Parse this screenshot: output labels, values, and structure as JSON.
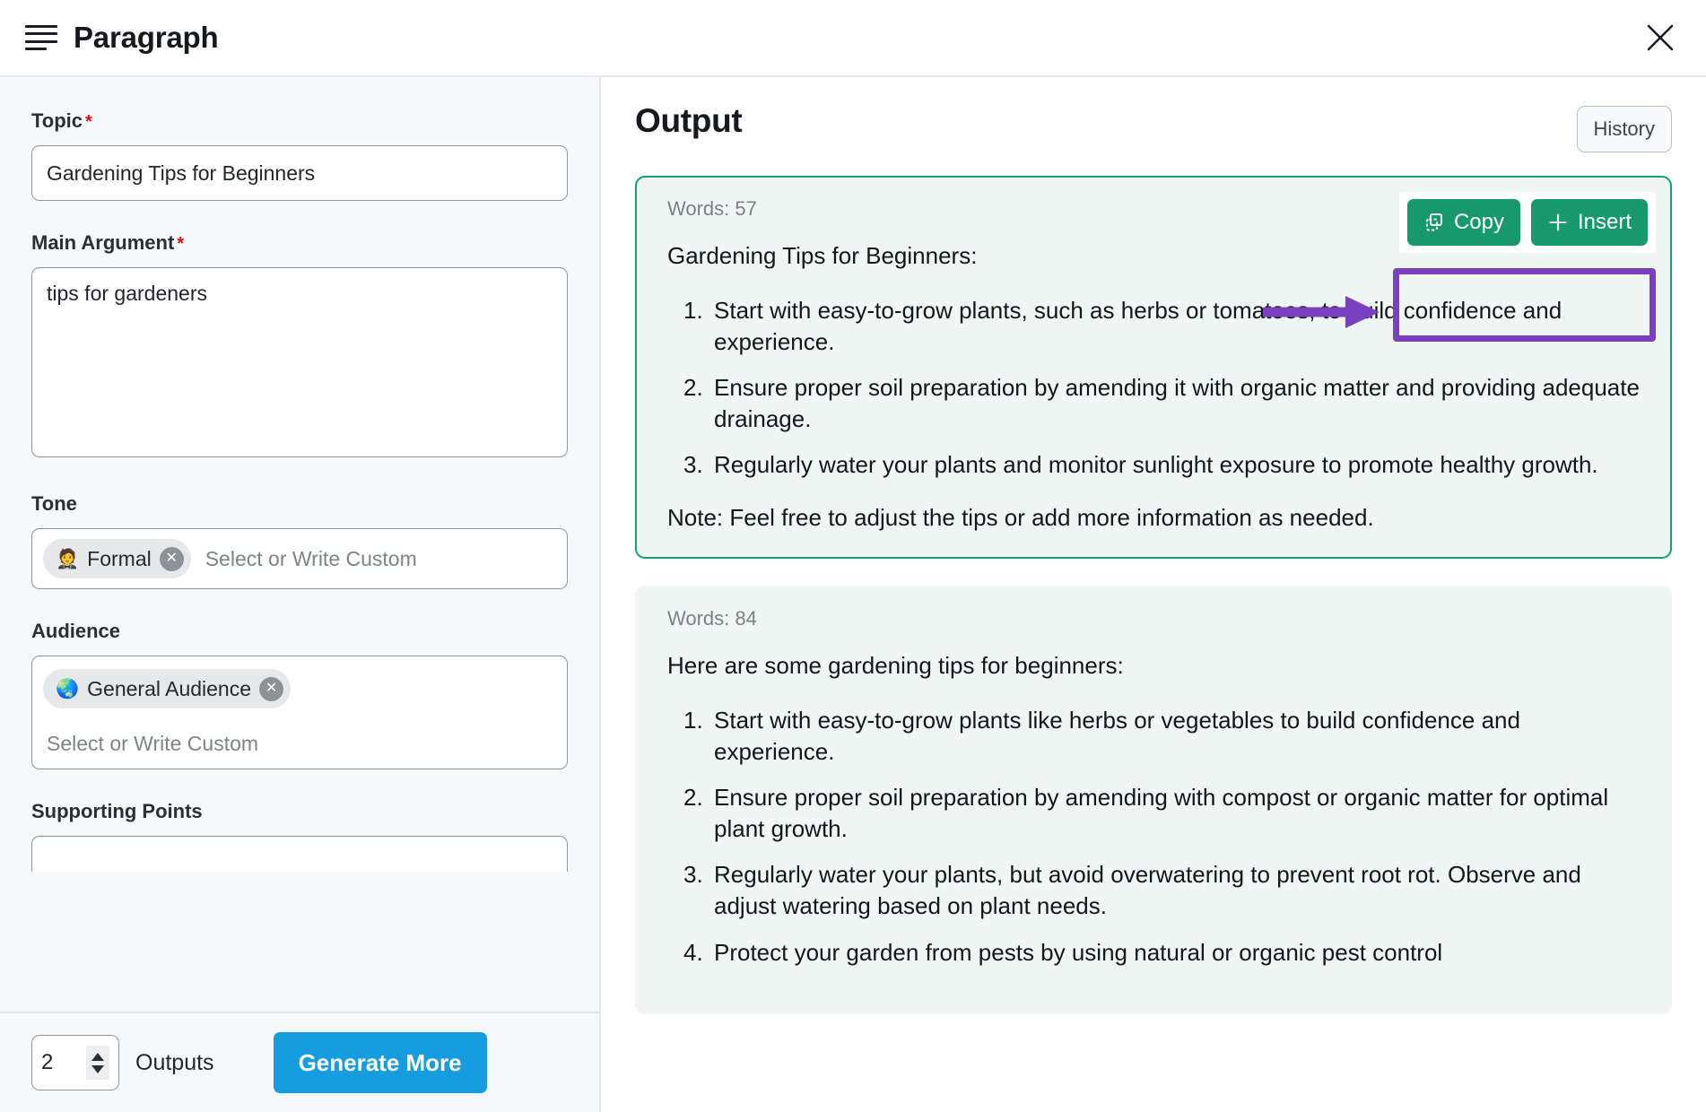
{
  "header": {
    "title": "Paragraph",
    "menu_icon": "paragraph-lines-icon",
    "close_icon": "close-icon"
  },
  "form": {
    "topic": {
      "label": "Topic",
      "required_mark": "*",
      "value": "Gardening Tips for Beginners",
      "placeholder": ""
    },
    "main_argument": {
      "label": "Main Argument",
      "required_mark": "*",
      "value": "tips for gardeners",
      "placeholder": ""
    },
    "tone": {
      "label": "Tone",
      "chip_emoji": "🤵",
      "chip_label": "Formal",
      "chip_remove": "✕",
      "placeholder": "Select or Write Custom"
    },
    "audience": {
      "label": "Audience",
      "chip_emoji": "🌏",
      "chip_label": "General Audience",
      "chip_remove": "✕",
      "placeholder": "Select or Write Custom"
    },
    "supporting_points": {
      "label": "Supporting Points"
    }
  },
  "footer": {
    "count_value": "2",
    "outputs_label": "Outputs",
    "generate_label": "Generate More",
    "generate_color": "#169ddf"
  },
  "output": {
    "title": "Output",
    "history_label": "History",
    "actions": {
      "copy_label": "Copy",
      "copy_icon": "copy-icon",
      "insert_label": "Insert",
      "insert_icon": "plus-icon",
      "button_color": "#17996d",
      "highlight_color": "#7b40c0"
    },
    "cards": [
      {
        "words_label": "Words: 57",
        "lead": "Gardening Tips for Beginners:",
        "items": [
          "Start with easy-to-grow plants, such as herbs or tomatoes, to build confidence and experience.",
          "Ensure proper soil preparation by amending it with organic matter and providing adequate drainage.",
          "Regularly water your plants and monitor sunlight exposure to promote healthy growth."
        ],
        "note": "Note: Feel free to adjust the tips or add more information as needed.",
        "selected": true,
        "border_color": "#13a077"
      },
      {
        "words_label": "Words: 84",
        "lead": "Here are some gardening tips for beginners:",
        "items": [
          "Start with easy-to-grow plants like herbs or vegetables to build confidence and experience.",
          "Ensure proper soil preparation by amending with compost or organic matter for optimal plant growth.",
          "Regularly water your plants, but avoid overwatering to prevent root rot. Observe and adjust watering based on plant needs.",
          "Protect your garden from pests by using natural or organic pest control"
        ],
        "note": "",
        "selected": false,
        "border_color": ""
      }
    ]
  }
}
